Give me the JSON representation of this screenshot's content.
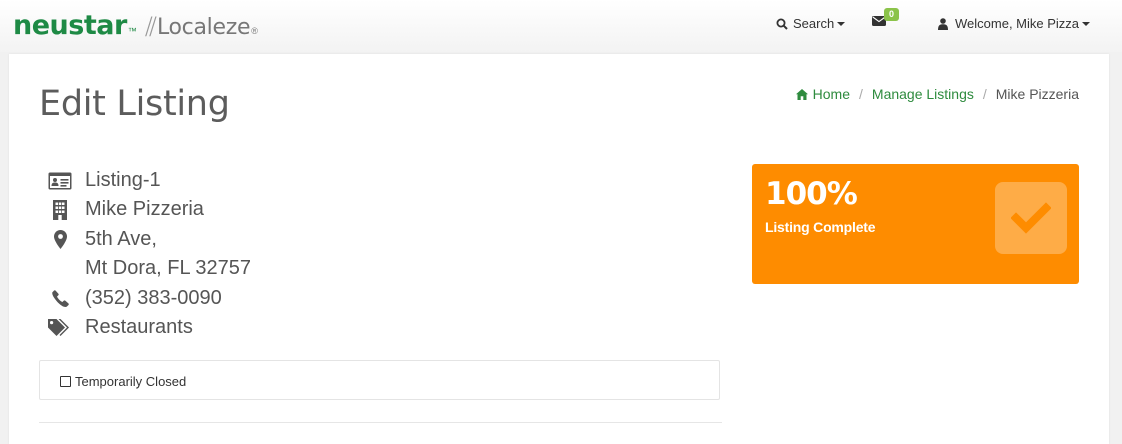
{
  "header": {
    "logo_primary": "neustar",
    "logo_primary_mark": "™",
    "logo_secondary": "Localeze",
    "logo_secondary_mark": "®",
    "search_label": "Search",
    "mail_count": "0",
    "welcome_label": "Welcome, Mike Pizza"
  },
  "page": {
    "title": "Edit Listing",
    "breadcrumb": {
      "home": "Home",
      "manage": "Manage Listings",
      "current": "Mike Pizzeria"
    }
  },
  "listing": {
    "id": "Listing-1",
    "name": "Mike Pizzeria",
    "address_line1": "5th Ave,",
    "address_line2": "Mt Dora, FL 32757",
    "phone": "(352) 383-0090",
    "category": "Restaurants",
    "icons": [
      "id-card-icon",
      "building-icon",
      "map-marker-icon",
      "phone-icon",
      "tags-icon"
    ]
  },
  "temporarily_closed": {
    "label": "Temporarily Closed",
    "checked": false
  },
  "completion": {
    "percent": "100%",
    "label": "Listing Complete",
    "value": 1.0,
    "color": "#fe8c00"
  }
}
